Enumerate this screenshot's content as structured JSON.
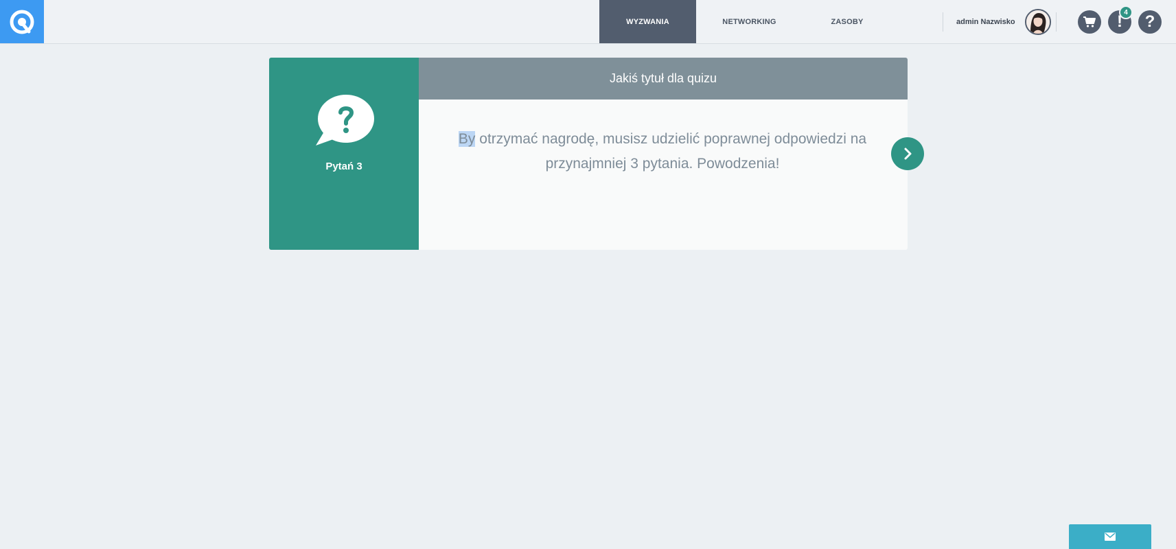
{
  "header": {
    "logo_icon": "q-logo-icon",
    "nav": [
      {
        "label": "WYZWANIA",
        "active": true
      },
      {
        "label": "NETWORKING",
        "active": false
      },
      {
        "label": "ZASOBY",
        "active": false
      }
    ],
    "user_name": "admin Nazwisko",
    "notifications_count": "4",
    "icons": [
      "cart-icon",
      "notifications-icon",
      "help-icon"
    ]
  },
  "quiz": {
    "title": "Jakiś tytuł dla quizu",
    "questions_label": "Pytań 3",
    "message_highlight": "By",
    "message_rest": " otrzymać nagrodę, musisz udzielić poprawnej odpowiedzi na przynajmniej 3 pytania. Powodzenia!",
    "next_icon": "chevron-right-icon"
  },
  "footer": {
    "mail_icon": "mail-icon"
  },
  "colors": {
    "brand_blue": "#3d9af2",
    "teal": "#2f9585",
    "nav_active": "#525d6e",
    "card_header": "#7f9099",
    "mail_button": "#3baec7"
  }
}
